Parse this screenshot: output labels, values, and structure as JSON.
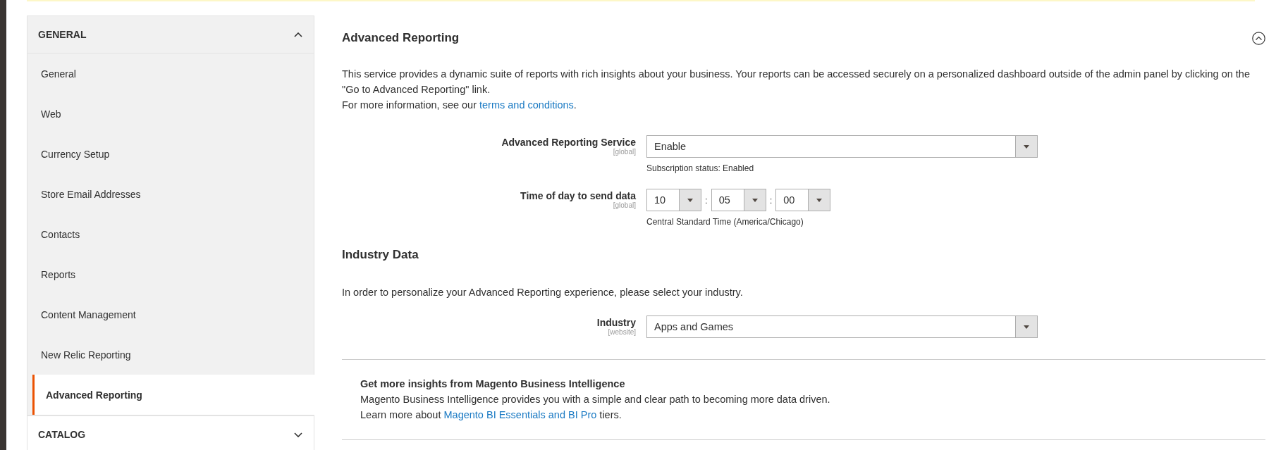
{
  "sidebar": {
    "groups": [
      {
        "title": "GENERAL",
        "expanded": true,
        "items": [
          {
            "label": "General",
            "selected": false
          },
          {
            "label": "Web",
            "selected": false
          },
          {
            "label": "Currency Setup",
            "selected": false
          },
          {
            "label": "Store Email Addresses",
            "selected": false
          },
          {
            "label": "Contacts",
            "selected": false
          },
          {
            "label": "Reports",
            "selected": false
          },
          {
            "label": "Content Management",
            "selected": false
          },
          {
            "label": "New Relic Reporting",
            "selected": false
          },
          {
            "label": "Advanced Reporting",
            "selected": true
          }
        ]
      },
      {
        "title": "CATALOG",
        "expanded": false
      }
    ]
  },
  "section": {
    "title": "Advanced Reporting",
    "expanded": true,
    "description": [
      "This service provides a dynamic suite of reports with rich insights about your business. Your reports can be accessed securely on a personalized dashboard outside of the admin panel by clicking on the \"Go to Advanced Reporting\" link."
    ],
    "info": {
      "text": "For more information, see our ",
      "link": "terms and conditions",
      "after": "."
    },
    "fields": [
      {
        "kind": "select",
        "label": "Advanced Reporting Service",
        "scope": "[global]",
        "value": "Enable",
        "note": "Subscription status: Enabled"
      },
      {
        "kind": "time",
        "label": "Time of day to send data",
        "scope": "[global]",
        "parts": [
          "10",
          "05",
          "00"
        ],
        "separator": ":",
        "note": "Central Standard Time (America/Chicago)"
      }
    ]
  },
  "industry": {
    "title": "Industry Data",
    "text": "In order to personalize your Advanced Reporting experience, please select your industry.",
    "fields": [
      {
        "kind": "select",
        "label": "Industry",
        "scope": "[website]",
        "value": "Apps and Games"
      }
    ]
  },
  "promo": {
    "title": "Get more insights from Magento Business Intelligence",
    "text": "Magento Business Intelligence provides you with a simple and clear path to becoming more data driven.",
    "more": {
      "text": "Learn more about ",
      "link": "Magento BI Essentials and BI Pro",
      "after": " tiers."
    }
  }
}
